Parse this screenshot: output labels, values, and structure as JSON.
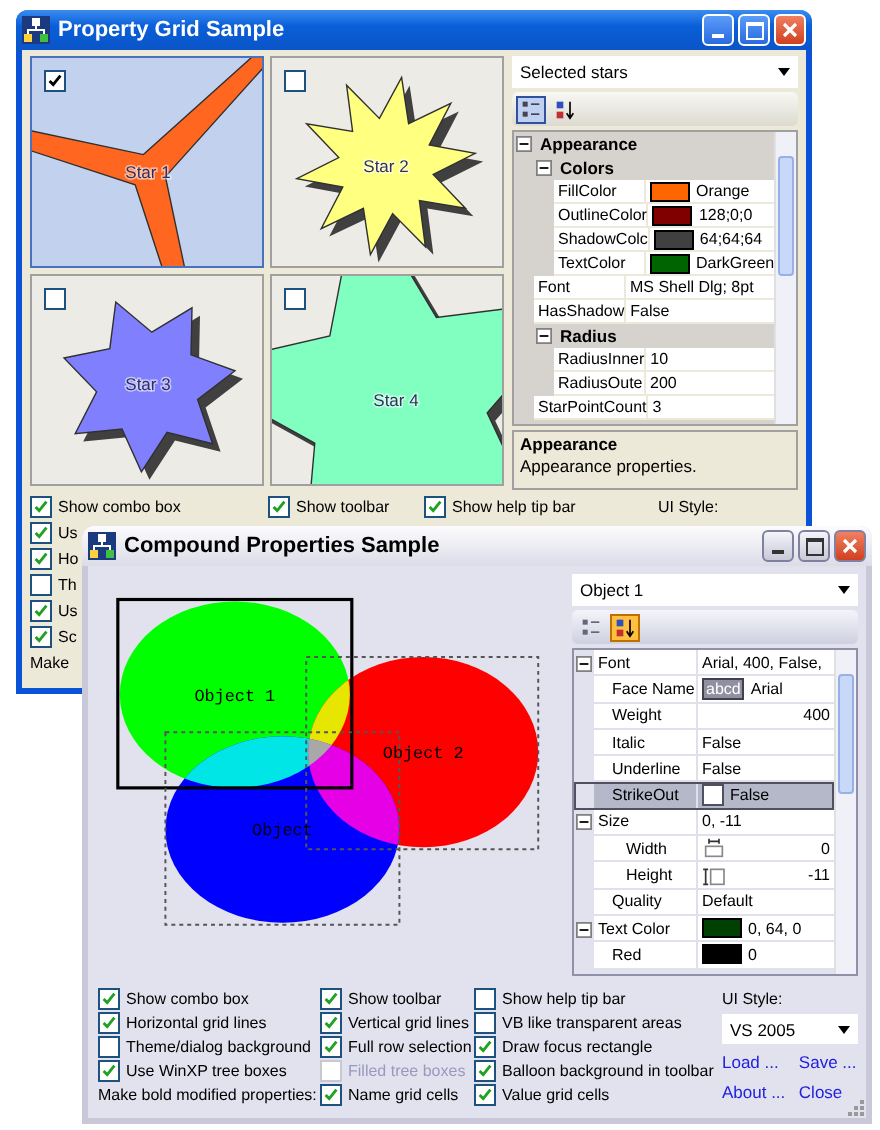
{
  "back_window": {
    "title": "Property Grid Sample",
    "stars": [
      {
        "label": "Star 1",
        "selected": true,
        "color": "#ff6620",
        "shadow": false
      },
      {
        "label": "Star 2",
        "selected": false,
        "color": "#ffff80",
        "shadow": true
      },
      {
        "label": "Star 3",
        "selected": false,
        "color": "#8080ff",
        "shadow": true
      },
      {
        "label": "Star 4",
        "selected": false,
        "color": "#80ffc0",
        "shadow": true
      }
    ],
    "selector": {
      "value": "Selected stars"
    },
    "toolbar": [
      {
        "kind": "categorized",
        "selected": true
      },
      {
        "kind": "alphabetical",
        "selected": false
      }
    ],
    "grid": {
      "rows": [
        {
          "name": "Appearance",
          "kind": "category",
          "expanded": true,
          "children": [
            {
              "name": "Colors",
              "kind": "category",
              "expanded": true,
              "children": [
                {
                  "name": "FillColor",
                  "kind": "swatch",
                  "value": "Orange",
                  "color": "#ff6600"
                },
                {
                  "name": "OutlineColor",
                  "kind": "swatch",
                  "value": "128;0;0",
                  "color": "#800000"
                },
                {
                  "name": "ShadowColc",
                  "kind": "swatch",
                  "value": "64;64;64",
                  "color": "#404040"
                },
                {
                  "name": "TextColor",
                  "kind": "swatch",
                  "value": "DarkGreen",
                  "color": "#006400"
                }
              ]
            },
            {
              "name": "Font",
              "kind": "text",
              "value": "MS Shell Dlg; 8pt"
            },
            {
              "name": "HasShadow",
              "kind": "text",
              "value": "False"
            },
            {
              "name": "Radius",
              "kind": "category",
              "expanded": true,
              "children": [
                {
                  "name": "RadiusInner",
                  "kind": "text",
                  "value": "10"
                },
                {
                  "name": "RadiusOute",
                  "kind": "text",
                  "value": "200"
                }
              ]
            },
            {
              "name": "StarPointCount",
              "kind": "text",
              "value": "3"
            }
          ]
        }
      ]
    },
    "description": {
      "title": "Appearance",
      "text": "Appearance properties."
    },
    "option_columns": [
      [
        {
          "kind": "checkbox",
          "label": "Show combo box",
          "checked": true
        },
        {
          "kind": "checkbox",
          "label": "Us",
          "checked": true
        },
        {
          "kind": "checkbox",
          "label": "Ho",
          "checked": true
        },
        {
          "kind": "checkbox",
          "label": "Th",
          "checked": false
        },
        {
          "kind": "checkbox",
          "label": "Us",
          "checked": true
        },
        {
          "kind": "checkbox",
          "label": "Sc",
          "checked": true
        },
        {
          "kind": "label",
          "label": "Make"
        }
      ],
      [
        {
          "kind": "checkbox",
          "label": "Show toolbar",
          "checked": true
        }
      ],
      [
        {
          "kind": "checkbox",
          "label": "Show help tip bar",
          "checked": true
        }
      ]
    ],
    "ui_style_label": "UI Style:"
  },
  "front_window": {
    "title": "Compound Properties Sample",
    "objects": [
      {
        "label": "Object 1",
        "color": "#00ff00",
        "selected": true
      },
      {
        "label": "Object 2",
        "color": "#ff0000",
        "selected": false
      },
      {
        "label": "Object",
        "color": "#0000ff",
        "selected": false
      }
    ],
    "selector": {
      "value": "Object 1"
    },
    "toolbar": [
      {
        "kind": "categorized",
        "selected": false
      },
      {
        "kind": "alphabetical",
        "selected": true
      }
    ],
    "grid": {
      "rows": [
        {
          "name": "Font",
          "kind": "text",
          "value": "Arial, 400, False,",
          "selected": false,
          "expanded": true,
          "children": [
            {
              "name": "Face Name",
              "kind": "font-sample",
              "sample": "abcd",
              "value": "Arial",
              "selected": false
            },
            {
              "name": "Weight",
              "kind": "number",
              "value": "400",
              "selected": false
            },
            {
              "name": "Italic",
              "kind": "text",
              "value": "False",
              "selected": false
            },
            {
              "name": "Underline",
              "kind": "text",
              "value": "False",
              "selected": false
            },
            {
              "name": "StrikeOut",
              "kind": "checkbox",
              "checked": false,
              "value": "False",
              "selected": true
            },
            {
              "name": "Size",
              "kind": "text",
              "value": "0, -11",
              "selected": false,
              "expanded": true,
              "children": [
                {
                  "name": "Width",
                  "kind": "width",
                  "value": "0",
                  "selected": false
                },
                {
                  "name": "Height",
                  "kind": "height",
                  "value": "-11",
                  "selected": false
                }
              ]
            },
            {
              "name": "Quality",
              "kind": "text",
              "value": "Default",
              "selected": false
            }
          ]
        },
        {
          "name": "Text Color",
          "kind": "swatch",
          "value": "0, 64, 0",
          "color": "#004000",
          "selected": false,
          "expanded": true,
          "children": [
            {
              "name": "Red",
              "kind": "swatch",
              "value": "0",
              "color": "#000000",
              "selected": false
            }
          ]
        }
      ]
    },
    "option_columns": [
      [
        {
          "kind": "checkbox",
          "label": "Show combo box",
          "checked": true,
          "disabled": false
        },
        {
          "kind": "checkbox",
          "label": "Horizontal grid lines",
          "checked": true,
          "disabled": false
        },
        {
          "kind": "checkbox",
          "label": "Theme/dialog background",
          "checked": false,
          "disabled": false
        },
        {
          "kind": "checkbox",
          "label": "Use WinXP tree boxes",
          "checked": true,
          "disabled": false
        },
        {
          "kind": "label",
          "label": "Make bold modified properties:"
        }
      ],
      [
        {
          "kind": "checkbox",
          "label": "Show toolbar",
          "checked": true,
          "disabled": false
        },
        {
          "kind": "checkbox",
          "label": "Vertical grid lines",
          "checked": true,
          "disabled": false
        },
        {
          "kind": "checkbox",
          "label": "Full row selection",
          "checked": true,
          "disabled": false
        },
        {
          "kind": "checkbox",
          "label": "Filled tree boxes",
          "checked": false,
          "disabled": true
        },
        {
          "kind": "checkbox",
          "label": "Name grid cells",
          "checked": true,
          "disabled": false
        }
      ],
      [
        {
          "kind": "checkbox",
          "label": "Show help tip bar",
          "checked": false,
          "disabled": false
        },
        {
          "kind": "checkbox",
          "label": "VB like transparent areas",
          "checked": false,
          "disabled": false
        },
        {
          "kind": "checkbox",
          "label": "Draw focus rectangle",
          "checked": true,
          "disabled": false
        },
        {
          "kind": "checkbox",
          "label": "Balloon background in toolbar",
          "checked": true,
          "disabled": false
        },
        {
          "kind": "checkbox",
          "label": "Value grid cells",
          "checked": true,
          "disabled": false
        }
      ]
    ],
    "ui_style": {
      "label": "UI Style:",
      "value": "VS 2005"
    },
    "links": [
      "Load ...",
      "Save ...",
      "About ...",
      "Close"
    ]
  }
}
